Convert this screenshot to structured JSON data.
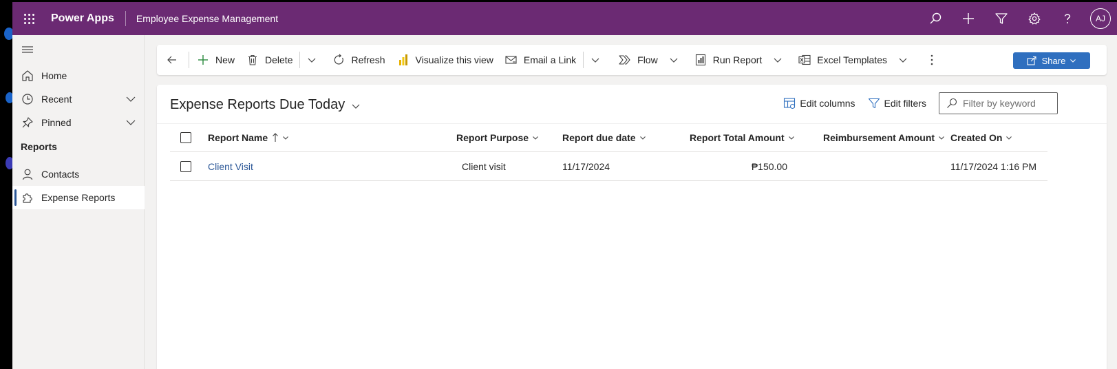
{
  "header": {
    "brand": "Power Apps",
    "app_name": "Employee Expense Management",
    "avatar_initials": "AJ"
  },
  "sidebar": {
    "items": [
      {
        "label": "Home"
      },
      {
        "label": "Recent"
      },
      {
        "label": "Pinned"
      }
    ],
    "group_title": "Reports",
    "group_items": [
      {
        "label": "Contacts"
      },
      {
        "label": "Expense Reports"
      }
    ]
  },
  "commandbar": {
    "new_label": "New",
    "delete_label": "Delete",
    "refresh_label": "Refresh",
    "visualize_label": "Visualize this view",
    "email_label": "Email a Link",
    "flow_label": "Flow",
    "run_report_label": "Run Report",
    "excel_label": "Excel Templates",
    "share_label": "Share"
  },
  "view": {
    "title": "Expense Reports Due Today",
    "edit_columns_label": "Edit columns",
    "edit_filters_label": "Edit filters",
    "filter_placeholder": "Filter by keyword"
  },
  "grid": {
    "columns": {
      "report_name": "Report Name",
      "report_purpose": "Report Purpose",
      "report_due_date": "Report due date",
      "report_total": "Report Total Amount",
      "reimbursement": "Reimbursement Amount",
      "created_on": "Created On"
    },
    "rows": [
      {
        "report_name": "Client Visit",
        "report_purpose": "Client visit",
        "report_due_date": "11/17/2024",
        "report_total": "₱150.00",
        "reimbursement": "",
        "created_on": "11/17/2024 1:16 PM"
      }
    ]
  },
  "colors": {
    "header_bg": "#6b2a73",
    "accent": "#2f6fbf",
    "link": "#2b5797"
  }
}
